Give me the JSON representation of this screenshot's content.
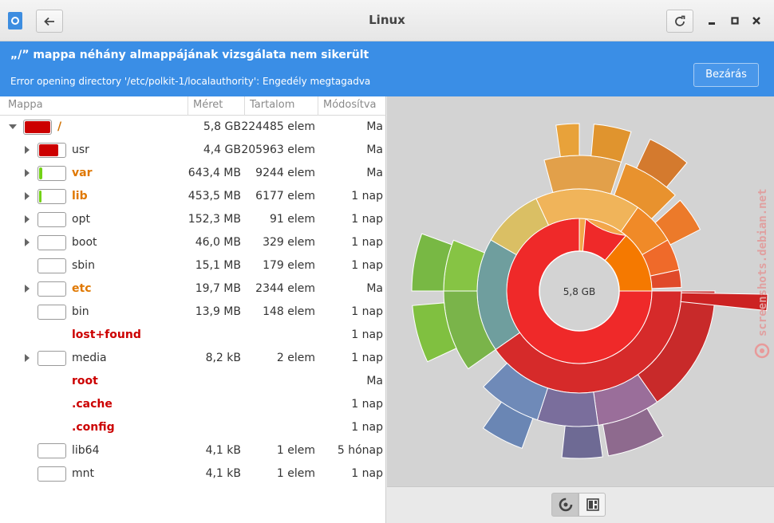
{
  "window": {
    "title": "Linux"
  },
  "banner": {
    "heading": "„/” mappa néhány almappájának vizsgálata nem sikerült",
    "detail": "Error opening directory '/etc/polkit-1/localauthority': Engedély megtagadva",
    "close_label": "Bezárás"
  },
  "tree": {
    "columns": [
      "Mappa",
      "Méret",
      "Tartalom",
      "Módosítva"
    ],
    "rows": [
      {
        "name": "/",
        "size": "5,8 GB",
        "contents": "224485 elem",
        "modified": "Ma",
        "expander": "open",
        "fill": 1.0,
        "fill_color": "#cc0000",
        "name_color": "#d07000",
        "bold": true,
        "bar": true,
        "level": 0
      },
      {
        "name": "usr",
        "size": "4,4 GB",
        "contents": "205963 elem",
        "modified": "Ma",
        "expander": "closed",
        "fill": 0.76,
        "fill_color": "#cc0000",
        "name_color": "#333333",
        "bold": false,
        "bar": true,
        "level": 1
      },
      {
        "name": "var",
        "size": "643,4 MB",
        "contents": "9244 elem",
        "modified": "Ma",
        "expander": "closed",
        "fill": 0.11,
        "fill_color": "#73d216",
        "name_color": "#e07800",
        "bold": true,
        "bar": true,
        "level": 1
      },
      {
        "name": "lib",
        "size": "453,5 MB",
        "contents": "6177 elem",
        "modified": "1 nap",
        "expander": "closed",
        "fill": 0.08,
        "fill_color": "#73d216",
        "name_color": "#e07800",
        "bold": true,
        "bar": true,
        "level": 1
      },
      {
        "name": "opt",
        "size": "152,3 MB",
        "contents": "91 elem",
        "modified": "1 nap",
        "expander": "closed",
        "fill": 0.0,
        "fill_color": "#73d216",
        "name_color": "#333333",
        "bold": false,
        "bar": true,
        "level": 1
      },
      {
        "name": "boot",
        "size": "46,0 MB",
        "contents": "329 elem",
        "modified": "1 nap",
        "expander": "closed",
        "fill": 0.0,
        "fill_color": "#73d216",
        "name_color": "#333333",
        "bold": false,
        "bar": true,
        "level": 1
      },
      {
        "name": "sbin",
        "size": "15,1 MB",
        "contents": "179 elem",
        "modified": "1 nap",
        "expander": "none",
        "fill": 0.0,
        "fill_color": "#73d216",
        "name_color": "#333333",
        "bold": false,
        "bar": true,
        "level": 1
      },
      {
        "name": "etc",
        "size": "19,7 MB",
        "contents": "2344 elem",
        "modified": "Ma",
        "expander": "closed",
        "fill": 0.0,
        "fill_color": "#73d216",
        "name_color": "#e07800",
        "bold": true,
        "bar": true,
        "level": 1
      },
      {
        "name": "bin",
        "size": "13,9 MB",
        "contents": "148 elem",
        "modified": "1 nap",
        "expander": "none",
        "fill": 0.0,
        "fill_color": "#73d216",
        "name_color": "#333333",
        "bold": false,
        "bar": true,
        "level": 1
      },
      {
        "name": "lost+found",
        "size": "",
        "contents": "",
        "modified": "1 nap",
        "expander": "none",
        "fill": 0.0,
        "fill_color": "#73d216",
        "name_color": "#cc0000",
        "bold": true,
        "bar": false,
        "level": 1
      },
      {
        "name": "media",
        "size": "8,2 kB",
        "contents": "2 elem",
        "modified": "1 nap",
        "expander": "closed",
        "fill": 0.0,
        "fill_color": "#73d216",
        "name_color": "#333333",
        "bold": false,
        "bar": true,
        "level": 1
      },
      {
        "name": "root",
        "size": "",
        "contents": "",
        "modified": "Ma",
        "expander": "none",
        "fill": 0.0,
        "fill_color": "#73d216",
        "name_color": "#cc0000",
        "bold": true,
        "bar": false,
        "level": 1
      },
      {
        "name": ".cache",
        "size": "",
        "contents": "",
        "modified": "1 nap",
        "expander": "none",
        "fill": 0.0,
        "fill_color": "#73d216",
        "name_color": "#cc0000",
        "bold": true,
        "bar": false,
        "level": 1
      },
      {
        "name": ".config",
        "size": "",
        "contents": "",
        "modified": "1 nap",
        "expander": "none",
        "fill": 0.0,
        "fill_color": "#73d216",
        "name_color": "#cc0000",
        "bold": true,
        "bar": false,
        "level": 1
      },
      {
        "name": "lib64",
        "size": "4,1 kB",
        "contents": "1 elem",
        "modified": "5 hónap",
        "expander": "none",
        "fill": 0.0,
        "fill_color": "#73d216",
        "name_color": "#333333",
        "bold": false,
        "bar": true,
        "level": 1
      },
      {
        "name": "mnt",
        "size": "4,1 kB",
        "contents": "1 elem",
        "modified": "1 nap",
        "expander": "none",
        "fill": 0.0,
        "fill_color": "#73d216",
        "name_color": "#333333",
        "bold": false,
        "bar": true,
        "level": 1
      }
    ]
  },
  "chart": {
    "center_label": "5,8 GB"
  },
  "watermark": "screenshots.debian.net"
}
